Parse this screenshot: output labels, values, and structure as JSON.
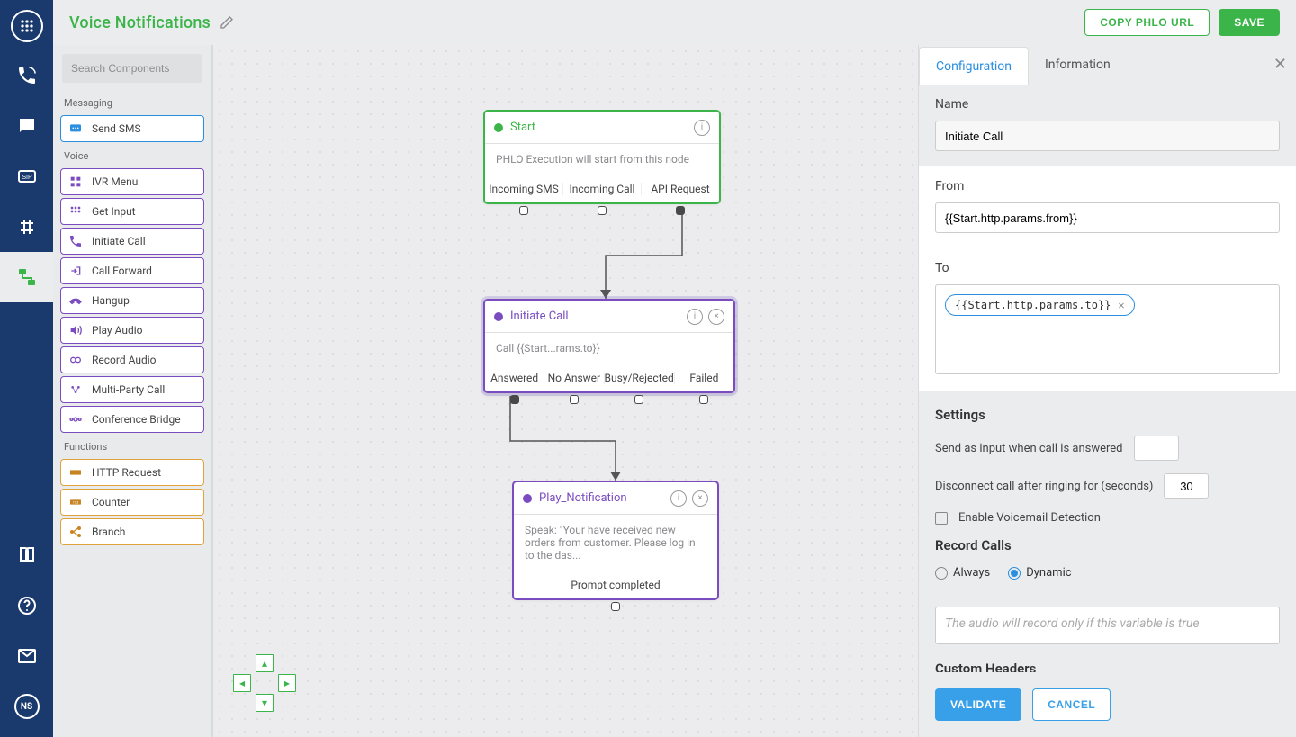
{
  "header": {
    "title": "Voice Notifications",
    "actions": {
      "copy": "COPY PHLO URL",
      "save": "SAVE"
    }
  },
  "nav": {
    "items": [
      {
        "name": "logo"
      },
      {
        "name": "voice"
      },
      {
        "name": "messaging"
      },
      {
        "name": "sip"
      },
      {
        "name": "numbers"
      },
      {
        "name": "phlo",
        "active": true
      }
    ],
    "bottom": [
      {
        "name": "docs"
      },
      {
        "name": "help"
      },
      {
        "name": "billing"
      },
      {
        "name": "account"
      }
    ]
  },
  "palette": {
    "search_placeholder": "Search Components",
    "sections": [
      {
        "title": "Messaging",
        "items": [
          {
            "label": "Send SMS",
            "variant": "blue",
            "icon": "sms"
          }
        ]
      },
      {
        "title": "Voice",
        "items": [
          {
            "label": "IVR Menu",
            "variant": "purple",
            "icon": "ivr"
          },
          {
            "label": "Get Input",
            "variant": "purple",
            "icon": "input"
          },
          {
            "label": "Initiate Call",
            "variant": "purple",
            "icon": "call"
          },
          {
            "label": "Call Forward",
            "variant": "purple",
            "icon": "forward"
          },
          {
            "label": "Hangup",
            "variant": "purple",
            "icon": "hangup"
          },
          {
            "label": "Play Audio",
            "variant": "purple",
            "icon": "audio"
          },
          {
            "label": "Record Audio",
            "variant": "purple",
            "icon": "record"
          },
          {
            "label": "Multi-Party Call",
            "variant": "purple",
            "icon": "multi"
          },
          {
            "label": "Conference Bridge",
            "variant": "purple",
            "icon": "conf"
          }
        ]
      },
      {
        "title": "Functions",
        "items": [
          {
            "label": "HTTP Request",
            "variant": "orange",
            "icon": "http"
          },
          {
            "label": "Counter",
            "variant": "orange",
            "icon": "counter"
          },
          {
            "label": "Branch",
            "variant": "orange",
            "icon": "branch"
          }
        ]
      }
    ]
  },
  "canvas": {
    "nodes": {
      "start": {
        "title": "Start",
        "body": "PHLO Execution will start from this node",
        "ports": [
          "Incoming SMS",
          "Incoming Call",
          "API Request"
        ]
      },
      "initiate": {
        "title": "Initiate Call",
        "body": "Call {{Start...rams.to}}",
        "ports": [
          "Answered",
          "No Answer",
          "Busy/Rejected",
          "Failed"
        ]
      },
      "play": {
        "title": "Play_Notification",
        "body": "Speak: \"Your have received new orders from customer. Please log in to the das...",
        "ports": [
          "Prompt completed"
        ]
      }
    }
  },
  "drawer": {
    "tabs": {
      "config": "Configuration",
      "info": "Information"
    },
    "name": {
      "label": "Name",
      "value": "Initiate Call"
    },
    "from": {
      "label": "From",
      "value": "{{Start.http.params.from}}"
    },
    "to": {
      "label": "To",
      "chip": "{{Start.http.params.to}}"
    },
    "settings": {
      "title": "Settings",
      "send_on_answer": "Send as input when call is answered",
      "send_on_answer_value": "",
      "disconnect": "Disconnect call after ringing for (seconds)",
      "disconnect_value": "30",
      "voicemail": "Enable Voicemail Detection"
    },
    "record": {
      "title": "Record Calls",
      "options": {
        "always": "Always",
        "dynamic": "Dynamic"
      },
      "placeholder": "The audio will record only if this variable is true"
    },
    "custom_headers": {
      "title": "Custom Headers"
    },
    "footer": {
      "validate": "VALIDATE",
      "cancel": "CANCEL"
    }
  }
}
